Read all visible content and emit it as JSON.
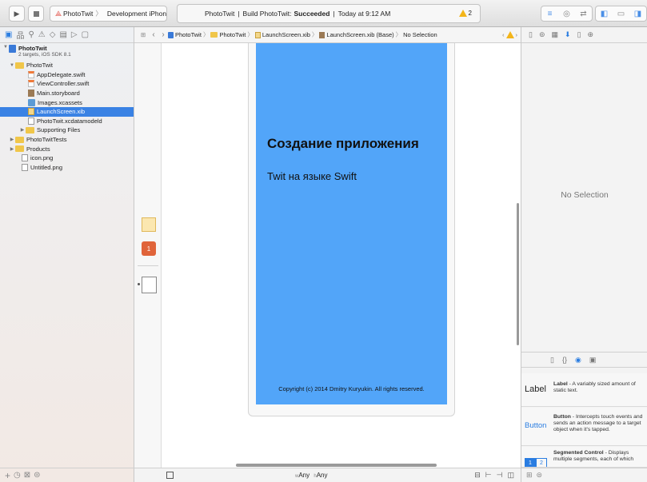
{
  "toolbar": {
    "scheme_name": "PhotoTwit",
    "destination": "Development iPhone",
    "activity_project": "PhotoTwit",
    "activity_build_prefix": "Build PhotoTwit:",
    "activity_build_status": "Succeeded",
    "activity_time": "Today at 9:12 AM",
    "warning_count": "2"
  },
  "navigator": {
    "project_name": "PhotoTwit",
    "project_subtitle": "2 targets, iOS SDK 8.1",
    "items": [
      {
        "label": "PhotoTwit"
      },
      {
        "label": "AppDelegate.swift"
      },
      {
        "label": "ViewController.swift"
      },
      {
        "label": "Main.storyboard"
      },
      {
        "label": "Images.xcassets"
      },
      {
        "label": "LaunchScreen.xib"
      },
      {
        "label": "PhotoTwit.xcdatamodeld"
      },
      {
        "label": "Supporting Files"
      },
      {
        "label": "PhotoTwitTests"
      },
      {
        "label": "Products"
      },
      {
        "label": "icon.png"
      },
      {
        "label": "Untitled.png"
      }
    ]
  },
  "jumpbar": {
    "crumbs": [
      "PhotoTwit",
      "PhotoTwit",
      "LaunchScreen.xib",
      "LaunchScreen.xib (Base)",
      "No Selection"
    ],
    "warning_count": "1"
  },
  "canvas": {
    "title": "Создание приложения",
    "subtitle": "Twit на языке Swift",
    "copyright": "Copyright (c) 2014 Dmitry Kuryukin. All rights reserved.",
    "background_color": "#52a5f9"
  },
  "size_class": {
    "w_prefix": "w",
    "w_value": "Any",
    "h_prefix": "h",
    "h_value": "Any"
  },
  "inspector": {
    "empty_text": "No Selection"
  },
  "library": {
    "items": [
      {
        "glyph": "Label",
        "name": "Label",
        "description": " - A variably sized amount of static text."
      },
      {
        "glyph": "Button",
        "name": "Button",
        "description": " - Intercepts touch events and sends an action message to a target object when it's tapped."
      },
      {
        "glyph": "1 2",
        "name": "Segmented Control",
        "description": " - Displays multiple segments, each of which"
      }
    ]
  },
  "colors": {
    "accent": "#2a7de1",
    "selection": "#3a82e4",
    "warning": "#f3b51a"
  }
}
